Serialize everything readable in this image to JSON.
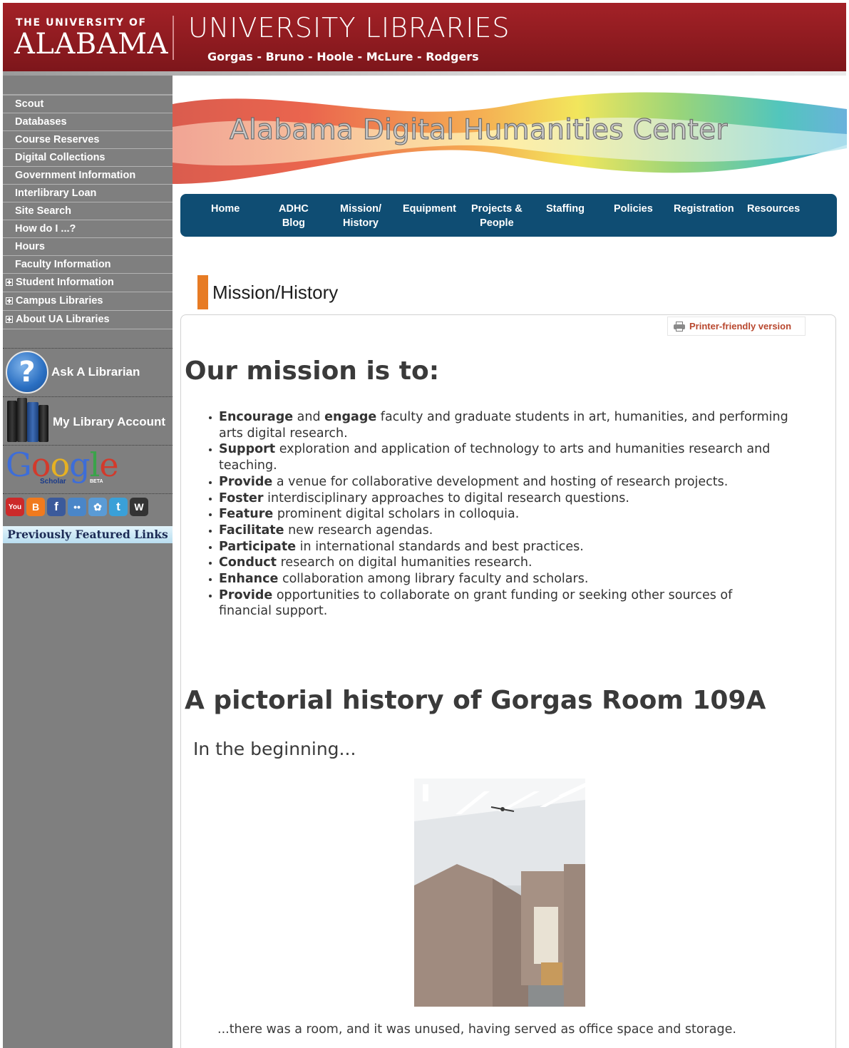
{
  "header": {
    "ua_small": "THE UNIVERSITY OF",
    "ua_big": "ALABAMA",
    "title": "UNIVERSITY LIBRARIES",
    "libraries": "Gorgas - Bruno - Hoole - McLure - Rodgers",
    "brand_color": "#9a1e23"
  },
  "sidebar": {
    "items": [
      {
        "label": "Scout"
      },
      {
        "label": "Databases"
      },
      {
        "label": "Course Reserves"
      },
      {
        "label": "Digital Collections"
      },
      {
        "label": "Government Information"
      },
      {
        "label": "Interlibrary Loan"
      },
      {
        "label": "Site Search"
      },
      {
        "label": "How do I ...?"
      },
      {
        "label": "Hours"
      },
      {
        "label": "Faculty Information"
      }
    ],
    "expandable": [
      {
        "label": "Student Information"
      },
      {
        "label": "Campus Libraries"
      },
      {
        "label": "About UA Libraries"
      }
    ],
    "ask_librarian": "Ask A Librarian",
    "ask_icon": "question-mark-icon",
    "my_account": "My Library Account",
    "google": {
      "word": [
        "G",
        "o",
        "o",
        "g",
        "l",
        "e"
      ],
      "sub": "Scholar",
      "beta": "BETA"
    },
    "social": [
      {
        "icon": "youtube-icon",
        "glyph": "You",
        "color": "#cc2a2a"
      },
      {
        "icon": "blogger-icon",
        "glyph": "B",
        "color": "#f07a1e"
      },
      {
        "icon": "facebook-icon",
        "glyph": "f",
        "color": "#3b5a9b"
      },
      {
        "icon": "flickr-icon",
        "glyph": "••",
        "color": "#4a86c8"
      },
      {
        "icon": "picasa-icon",
        "glyph": "✿",
        "color": "#5a9bd5"
      },
      {
        "icon": "twitter-icon",
        "glyph": "t",
        "color": "#3aa0d8"
      },
      {
        "icon": "wordpress-icon",
        "glyph": "W",
        "color": "#333333"
      }
    ],
    "previously_featured": "Previously Featured Links"
  },
  "banner": {
    "title": "Alabama Digital Humanities Center"
  },
  "topnav": {
    "color": "#0f4d73",
    "items": [
      {
        "label": "Home"
      },
      {
        "label": "ADHC\nBlog"
      },
      {
        "label": "Mission/\nHistory"
      },
      {
        "label": "Equipment"
      },
      {
        "label": "Projects &\nPeople"
      },
      {
        "label": "Staffing"
      },
      {
        "label": "Policies"
      },
      {
        "label": "Registration"
      },
      {
        "label": "Resources"
      }
    ]
  },
  "page": {
    "title": "Mission/History",
    "printer_label": "Printer-friendly version",
    "mission_heading": "Our mission is to:",
    "mission_items": [
      {
        "bold": "Encourage",
        "mid": " and ",
        "bold2": "engage",
        "rest": " faculty and graduate students in art, humanities, and performing arts digital research."
      },
      {
        "bold": "Support",
        "rest": " exploration and application of technology to arts and humanities research and teaching."
      },
      {
        "bold": "Provide",
        "rest": " a venue for collaborative development and hosting of research projects."
      },
      {
        "bold": "Foster",
        "rest": " interdisciplinary approaches to digital research questions."
      },
      {
        "bold": "Feature",
        "rest": " prominent digital scholars in colloquia."
      },
      {
        "bold": "Facilitate",
        "rest": " new research agendas."
      },
      {
        "bold": "Participate",
        "rest": " in international standards and best practices."
      },
      {
        "bold": "Conduct",
        "rest": " research on digital humanities research."
      },
      {
        "bold": "Enhance",
        "rest": " collaboration among library faculty and scholars."
      },
      {
        "bold": "Provide",
        "rest": " opportunities to collaborate on grant funding or seeking other sources of financial support."
      }
    ],
    "history_heading": "A pictorial history of Gorgas Room 109A",
    "beginning": "In the beginning...",
    "caption": "...there was a room, and it was unused, having served as office space and storage."
  }
}
